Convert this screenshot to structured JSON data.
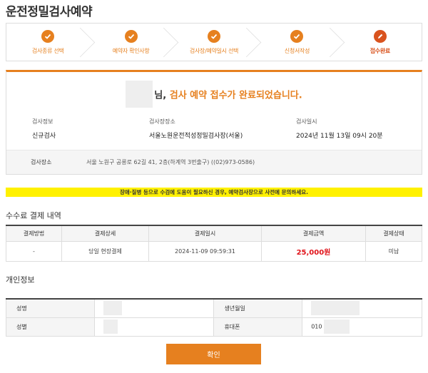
{
  "page_title": "운전정밀검사예약",
  "colors": {
    "accent": "#e6801f",
    "amount": "#e0131a",
    "notice_bg": "#fff100"
  },
  "steps": [
    {
      "label": "검사종류 선택",
      "icon": "check-icon"
    },
    {
      "label": "예약자 확인사항",
      "icon": "check-icon"
    },
    {
      "label": "검사장/예약일시 선택",
      "icon": "check-icon"
    },
    {
      "label": "신청서작성",
      "icon": "check-icon"
    },
    {
      "label": "접수완료",
      "icon": "pencil-icon"
    }
  ],
  "confirmation": {
    "headline_suffix": "님, ",
    "headline_accent": "검사 예약 접수가 완료되었습니다.",
    "exam_info_label": "검사정보",
    "exam_info_value": "신규검사",
    "exam_site_label": "검사장장소",
    "exam_site_value": "서울노원운전적성정밀검사장(서울)",
    "exam_datetime_label": "검사일시",
    "exam_datetime_value": "2024년 11월 13일 09시 20분",
    "location_label": "검사장소",
    "location_value": "서울 노원구 공릉로 62길 41, 2층(하계역 3번출구) ((02)973-0586)"
  },
  "notice": "장애·질병 등으로 수검에 도움이 필요하신 경우, 예약검사장으로 사전에 문의하세요.",
  "payment": {
    "title": "수수료 결제 내역",
    "headers": [
      "결제방법",
      "결제상세",
      "결제일시",
      "결제금액",
      "결제상태"
    ],
    "row": [
      "-",
      "당일 현장결제",
      "2024-11-09 09:59:31",
      "25,000원",
      "미납"
    ]
  },
  "personal": {
    "title": "개인정보",
    "name_label": "성명",
    "birth_label": "생년월일",
    "gender_label": "성별",
    "phone_label": "휴대폰",
    "phone_prefix": "010"
  },
  "confirm_button": "확인"
}
